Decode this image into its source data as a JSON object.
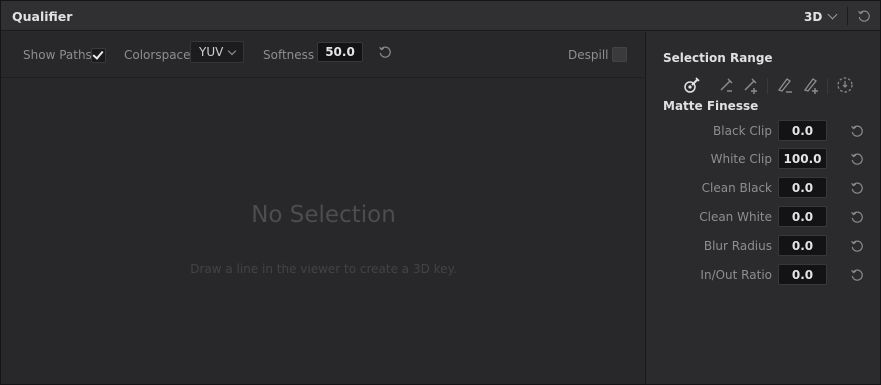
{
  "header": {
    "title": "Qualifier",
    "mode_value": "3D"
  },
  "toolbar": {
    "show_paths_label": "Show Paths",
    "show_paths_checked": true,
    "colorspace_label": "Colorspace",
    "colorspace_value": "YUV",
    "softness_label": "Softness",
    "softness_value": "50.0",
    "despill_label": "Despill",
    "despill_checked": false
  },
  "viewer": {
    "empty_title": "No Selection",
    "empty_hint": "Draw a line in the viewer to create a 3D key."
  },
  "selection_range": {
    "title": "Selection Range",
    "tools": [
      "picker-icon",
      "pick-subtract-icon",
      "pick-add-icon",
      "pen-subtract-icon",
      "pen-add-icon",
      "highlight-icon"
    ]
  },
  "matte_finesse": {
    "title": "Matte Finesse",
    "params": [
      {
        "label": "Black Clip",
        "value": "0.0"
      },
      {
        "label": "White Clip",
        "value": "100.0"
      },
      {
        "label": "Clean Black",
        "value": "0.0"
      },
      {
        "label": "Clean White",
        "value": "0.0"
      },
      {
        "label": "Blur Radius",
        "value": "0.0"
      },
      {
        "label": "In/Out Ratio",
        "value": "0.0"
      }
    ]
  },
  "colors": {
    "panel_bg": "#2a2a2d",
    "header_bg": "#303033",
    "field_bg": "#131315",
    "text_dim": "#8e8e90",
    "text_bright": "#e2e2e4"
  }
}
